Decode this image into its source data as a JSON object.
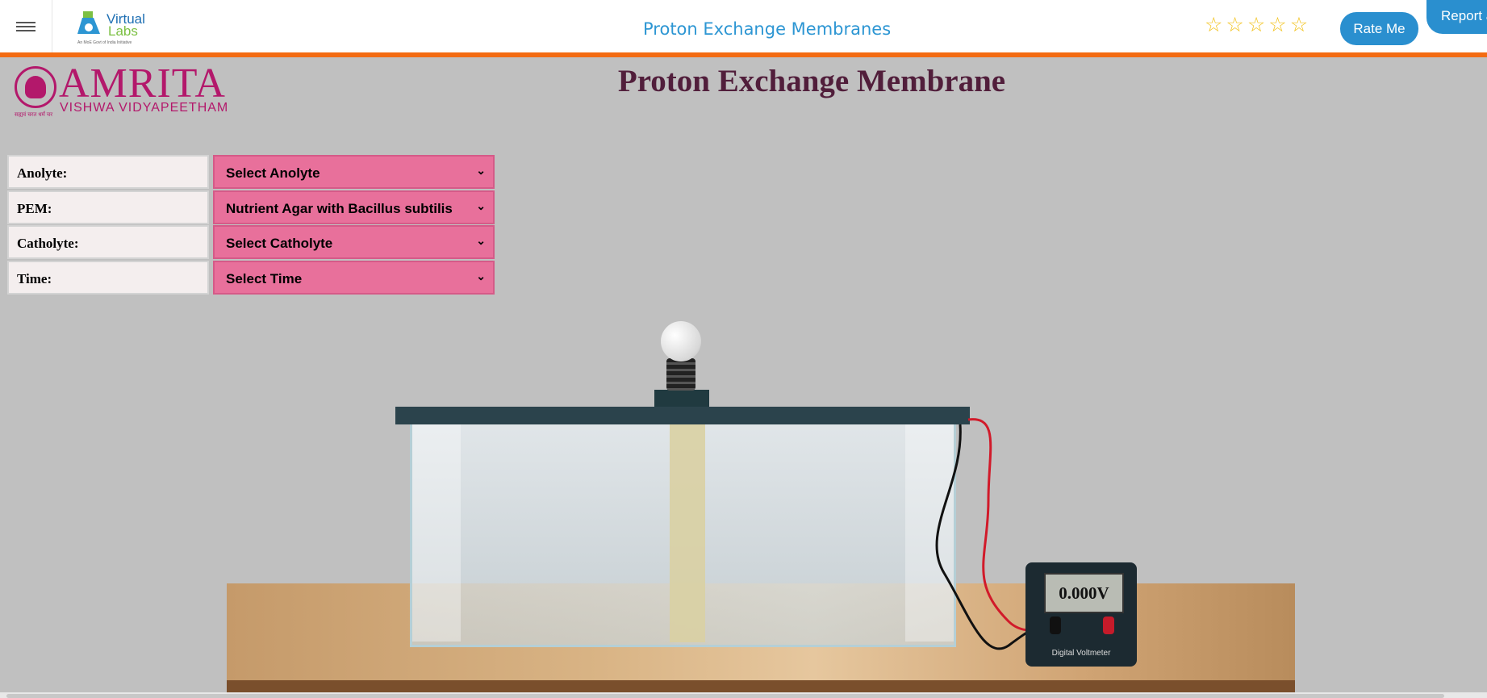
{
  "header": {
    "app_title": "Proton Exchange Membranes",
    "logo": {
      "name": "Virtual",
      "name2": "Labs",
      "tagline": "An MoE Govt of India Initiative"
    },
    "rating": {
      "stars": 5,
      "filled": 0
    },
    "rate_button": "Rate Me",
    "report_button": "Report a"
  },
  "brand": {
    "name": "AMRITA",
    "subtitle": "VISHWA VIDYAPEETHAM",
    "motto": "सह्यवं चरत धर्मं चर"
  },
  "page_title": "Proton Exchange Membrane",
  "controls": [
    {
      "label": "Anolyte:",
      "value": "Select Anolyte"
    },
    {
      "label": "PEM:",
      "value": "Nutrient Agar with Bacillus subtilis"
    },
    {
      "label": "Catholyte:",
      "value": "Select Catholyte"
    },
    {
      "label": "Time:",
      "value": "Select Time"
    }
  ],
  "voltmeter": {
    "reading": "0.000V",
    "label": "Digital Voltmeter"
  },
  "colors": {
    "accent": "#f36b12",
    "brand": "#b3186b",
    "select_bg": "#e8709b",
    "button": "#2a8fcf"
  }
}
